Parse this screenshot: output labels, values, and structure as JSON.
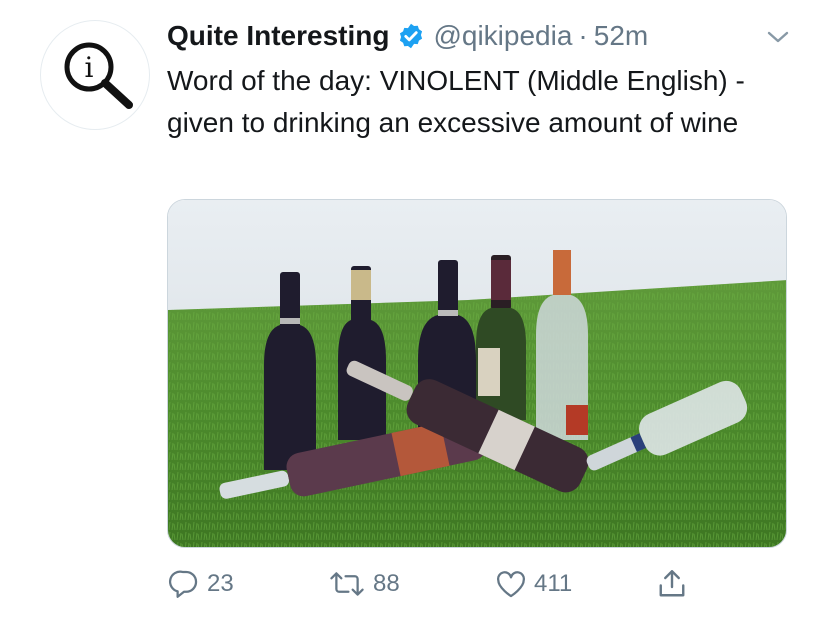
{
  "tweet": {
    "display_name": "Quite Interesting",
    "handle": "@qikipedia",
    "separator": "·",
    "time": "52m",
    "text": "Word of the day: VINOLENT (Middle English) - given to drinking an excessive amount of wine",
    "avatar_letter": "i"
  },
  "actions": {
    "replies": "23",
    "retweets": "88",
    "likes": "411"
  },
  "icons": {
    "avatar": "magnifier-i-logo-icon",
    "verified": "verified-badge-icon",
    "menu": "chevron-down-icon",
    "reply": "reply-icon",
    "retweet": "retweet-icon",
    "like": "heart-icon",
    "share": "share-icon"
  },
  "colors": {
    "accent": "#1da1f2",
    "muted": "#657786",
    "text": "#14171a"
  }
}
